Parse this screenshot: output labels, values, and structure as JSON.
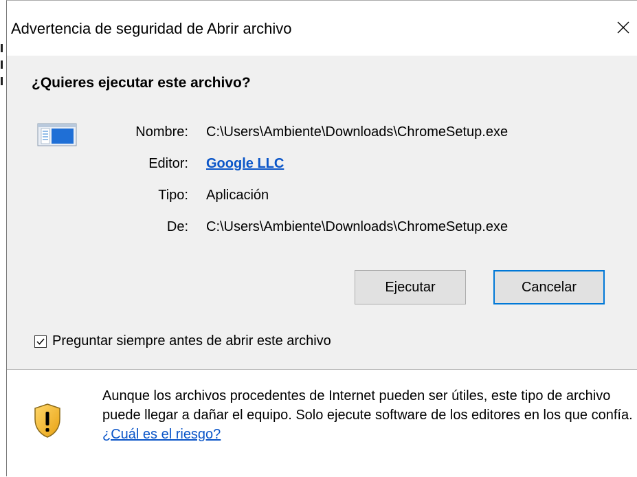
{
  "window": {
    "title": "Advertencia de seguridad de Abrir archivo",
    "close_icon": "close-icon"
  },
  "dialog": {
    "question": "¿Quieres ejecutar este archivo?",
    "file_icon": "application-window-icon",
    "fields": {
      "name_label": "Nombre:",
      "name_value": "C:\\Users\\Ambiente\\Downloads\\ChromeSetup.exe",
      "publisher_label": "Editor:",
      "publisher_value": "Google LLC",
      "type_label": "Tipo:",
      "type_value": "Aplicación",
      "from_label": "De:",
      "from_value": "C:\\Users\\Ambiente\\Downloads\\ChromeSetup.exe"
    },
    "buttons": {
      "run_label": "Ejecutar",
      "cancel_label": "Cancelar"
    },
    "checkbox": {
      "label": "Preguntar siempre antes de abrir este archivo",
      "checked": true
    }
  },
  "footer": {
    "shield_icon": "warning-shield-icon",
    "warning_text": "Aunque los archivos procedentes de Internet pueden ser útiles, este tipo de archivo puede llegar a dañar el equipo. Solo ejecute software de los editores en los que confía.",
    "risk_link": "¿Cuál es el riesgo?"
  },
  "colors": {
    "link": "#0a55c8",
    "focus_border": "#0078d7",
    "dialog_bg": "#f0f0f0"
  }
}
